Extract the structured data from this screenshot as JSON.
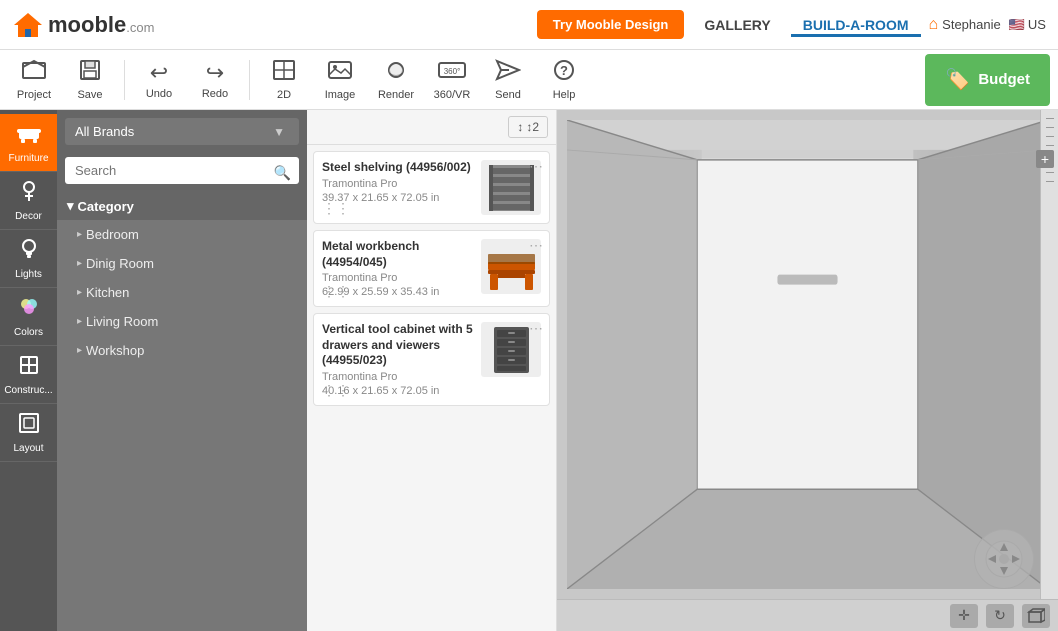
{
  "header": {
    "logo_text": "mooble",
    "logo_suffix": ".com",
    "try_btn": "Try Mooble Design",
    "nav_gallery": "GALLERY",
    "nav_build": "BUILD-A-ROOM",
    "nav_user": "Stephanie",
    "nav_lang": "US"
  },
  "toolbar": {
    "project_label": "Project",
    "save_label": "Save",
    "undo_label": "Undo",
    "redo_label": "Redo",
    "view2d_label": "2D",
    "image_label": "Image",
    "render_label": "Render",
    "view360_label": "360/VR",
    "send_label": "Send",
    "help_label": "Help",
    "budget_label": "Budget"
  },
  "sidebar": {
    "items": [
      {
        "id": "furniture",
        "label": "Furniture",
        "icon": "🪑",
        "active": true
      },
      {
        "id": "decor",
        "label": "Decor",
        "icon": "🌿"
      },
      {
        "id": "lights",
        "label": "Lights",
        "icon": "💡"
      },
      {
        "id": "colors",
        "label": "Colors",
        "icon": "🎨"
      },
      {
        "id": "construction",
        "label": "Construc...",
        "icon": "🏗️"
      },
      {
        "id": "layout",
        "label": "Layout",
        "icon": "📐"
      }
    ]
  },
  "category_panel": {
    "brand_placeholder": "All Brands",
    "search_placeholder": "Search",
    "category_header": "Category",
    "categories": [
      {
        "label": "Bedroom"
      },
      {
        "label": "Dinig Room"
      },
      {
        "label": "Kitchen"
      },
      {
        "label": "Living Room"
      },
      {
        "label": "Workshop"
      }
    ]
  },
  "products": {
    "sort_label": "↕2",
    "items": [
      {
        "name": "Steel shelving (44956/002)",
        "brand": "Tramontina Pro",
        "dims": "39.37 x 21.65 x 72.05 in",
        "color": "#555"
      },
      {
        "name": "Metal workbench (44954/045)",
        "brand": "Tramontina Pro",
        "dims": "62.99 x 25.59 x 35.43 in",
        "color": "#cc5500"
      },
      {
        "name": "Vertical tool cabinet with 5 drawers and viewers (44955/023)",
        "brand": "Tramontina Pro",
        "dims": "40.16 x 21.65 x 72.05 in",
        "color": "#444"
      }
    ]
  }
}
